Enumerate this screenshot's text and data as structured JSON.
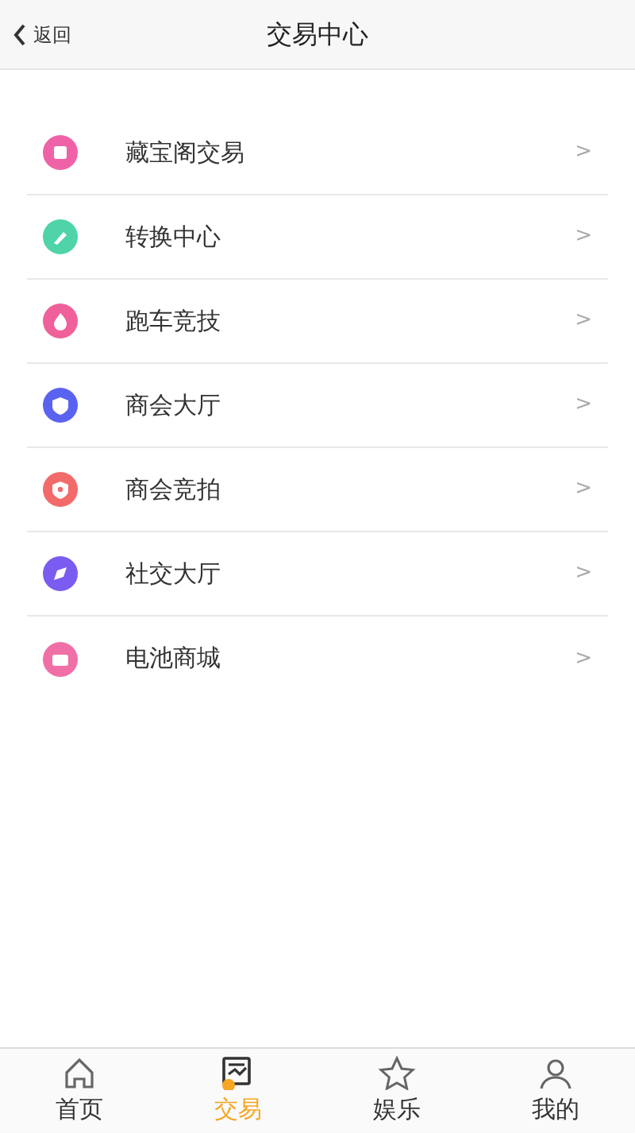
{
  "header": {
    "back_label": "返回",
    "title": "交易中心"
  },
  "menu": [
    {
      "label": "藏宝阁交易",
      "kind": "treasure",
      "color": "#f062a8",
      "chevron": ">"
    },
    {
      "label": "转换中心",
      "kind": "exchange",
      "color": "#4fd3a8",
      "chevron": ">"
    },
    {
      "label": "跑车竞技",
      "kind": "race",
      "color": "#f0609a",
      "chevron": ">"
    },
    {
      "label": "商会大厅",
      "kind": "hall",
      "color": "#5a63f0",
      "chevron": ">"
    },
    {
      "label": "商会竞拍",
      "kind": "auction",
      "color": "#f36a6a",
      "chevron": ">"
    },
    {
      "label": "社交大厅",
      "kind": "social",
      "color": "#7a5cf0",
      "chevron": ">"
    },
    {
      "label": "电池商城",
      "kind": "battery",
      "color": "#f06fa6",
      "chevron": ">"
    }
  ],
  "tab_bar": [
    {
      "label": "首页",
      "kind": "home",
      "selected": false
    },
    {
      "label": "交易",
      "kind": "trade",
      "selected": true
    },
    {
      "label": "娱乐",
      "kind": "fun",
      "selected": false
    },
    {
      "label": "我的",
      "kind": "me",
      "selected": false
    }
  ]
}
